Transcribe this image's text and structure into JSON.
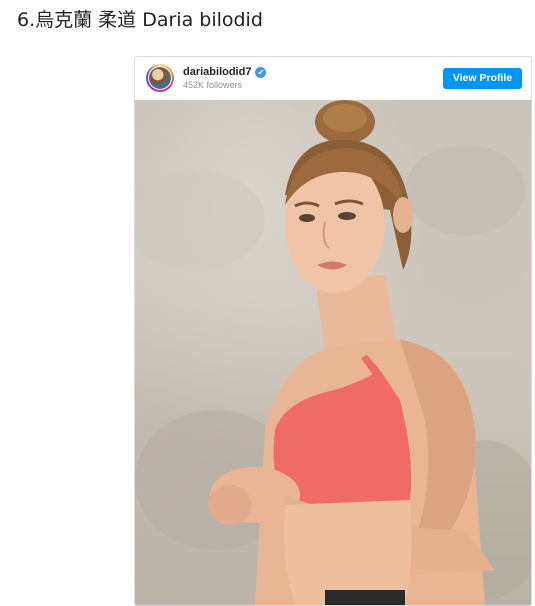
{
  "article": {
    "heading": "6.烏克蘭 柔道 Daria bilodid"
  },
  "instagram_embed": {
    "username": "dariabilodid7",
    "followers": "452K followers",
    "view_profile_label": "View Profile",
    "verified_icon": "✔",
    "colors": {
      "button": "#0095f6",
      "verified": "#3897f0",
      "followers_text": "#8e8e8e"
    }
  }
}
